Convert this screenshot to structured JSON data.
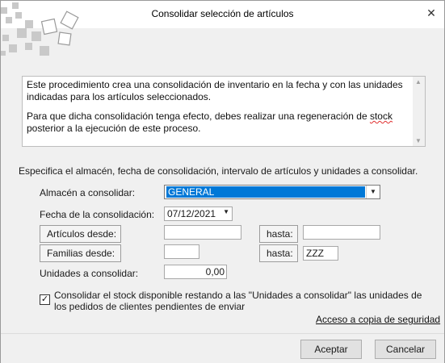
{
  "window": {
    "title": "Consolidar selección de artículos",
    "close_glyph": "✕"
  },
  "description": {
    "paragraph1": "Este procedimiento crea una consolidación de inventario en la fecha y con las unidades indicadas para los artículos seleccionados.",
    "paragraph2_start": "Para que dicha consolidación tenga efecto, debes realizar una regeneración de ",
    "paragraph2_word": "stock",
    "paragraph2_end": " posterior a la ejecución de este proceso."
  },
  "form": {
    "instructions": "Especifica el almacén, fecha de consolidación, intervalo de artículos y unidades a consolidar.",
    "almacen_label": "Almacén a consolidar:",
    "almacen_value": "GENERAL",
    "fecha_label": "Fecha de la consolidación:",
    "fecha_value": "07/12/2021",
    "articulos_desde_label": "Artículos desde:",
    "articulos_desde_value": "",
    "articulos_hasta_label": "hasta:",
    "articulos_hasta_value": "",
    "familias_desde_label": "Familias desde:",
    "familias_desde_value": "",
    "familias_hasta_label": "hasta:",
    "familias_hasta_value": "ZZZ",
    "unidades_label": "Unidades a consolidar:",
    "unidades_value": "0,00",
    "consolidar_checkbox_checked": true,
    "consolidar_checkbox_label": "Consolidar el stock disponible restando a las \"Unidades a consolidar\" las unidades de los pedidos de clientes pendientes de enviar",
    "backup_link": "Acceso a copia de seguridad"
  },
  "buttons": {
    "accept": "Aceptar",
    "cancel": "Cancelar"
  },
  "icons": {
    "logo": "scattered-squares-logo",
    "close": "close-icon",
    "combo_arrow": "chevron-down-icon",
    "date_arrow": "chevron-down-icon",
    "check": "checkmark-icon"
  },
  "colors": {
    "selection": "#0078d7",
    "dialog_background": "#f0f0f0"
  }
}
